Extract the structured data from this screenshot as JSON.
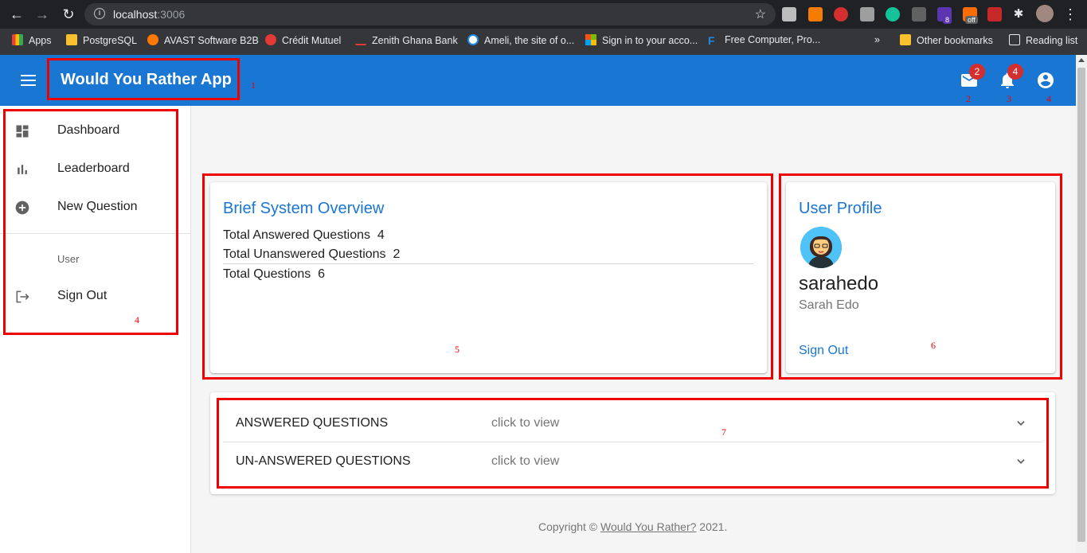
{
  "browser": {
    "url_host": "localhost",
    "url_port": ":3006",
    "bookmarks": [
      {
        "label": "Apps",
        "color": "#ea4335"
      },
      {
        "label": "PostgreSQL",
        "color": "#fbc02d"
      },
      {
        "label": "AVAST Software B2B",
        "color": "#ff7800"
      },
      {
        "label": "Crédit Mutuel",
        "color": "#e53935"
      },
      {
        "label": "Zenith Ghana Bank",
        "color": "#e53935"
      },
      {
        "label": "Ameli, the site of o...",
        "color": "#1e88e5"
      },
      {
        "label": "Sign in to your acco...",
        "color": "#7cbb00"
      },
      {
        "label": "Free Computer, Pro...",
        "color": "#1e88e5"
      },
      {
        "label": "»",
        "color": ""
      },
      {
        "label": "Other bookmarks",
        "color": "#fbc02d"
      },
      {
        "label": "Reading list",
        "color": "#e8eaed"
      }
    ],
    "ext_badge_1": "8",
    "ext_badge_2": "off"
  },
  "appbar": {
    "title": "Would You Rather App",
    "mail_count": "2",
    "notifications_count": "4",
    "color": "#1976d2"
  },
  "drawer": {
    "items": [
      {
        "label": "Dashboard",
        "icon": "dashboard-icon"
      },
      {
        "label": "Leaderboard",
        "icon": "bar-chart-icon"
      },
      {
        "label": "New Question",
        "icon": "add-circle-icon"
      }
    ],
    "subheader": "User",
    "signout": {
      "label": "Sign Out",
      "icon": "logout-icon"
    }
  },
  "overview": {
    "title": "Brief System Overview",
    "answered_label": "Total Answered Questions",
    "answered_value": "4",
    "unanswered_label": "Total Unanswered Questions",
    "unanswered_value": "2",
    "total_label": "Total Questions",
    "total_value": "6"
  },
  "profile": {
    "title": "User Profile",
    "username": "sarahedo",
    "fullname": "Sarah Edo",
    "signout": "Sign Out"
  },
  "accordion": [
    {
      "title": "ANSWERED QUESTIONS",
      "subtitle": "click to view"
    },
    {
      "title": "UN-ANSWERED QUESTIONS",
      "subtitle": "click to view"
    }
  ],
  "footer": {
    "prefix": "Copyright © ",
    "link": "Would You Rather?",
    "suffix": " 2021."
  },
  "annotations": [
    "1",
    "2",
    "3",
    "4",
    "4",
    "5",
    "6",
    "7"
  ]
}
